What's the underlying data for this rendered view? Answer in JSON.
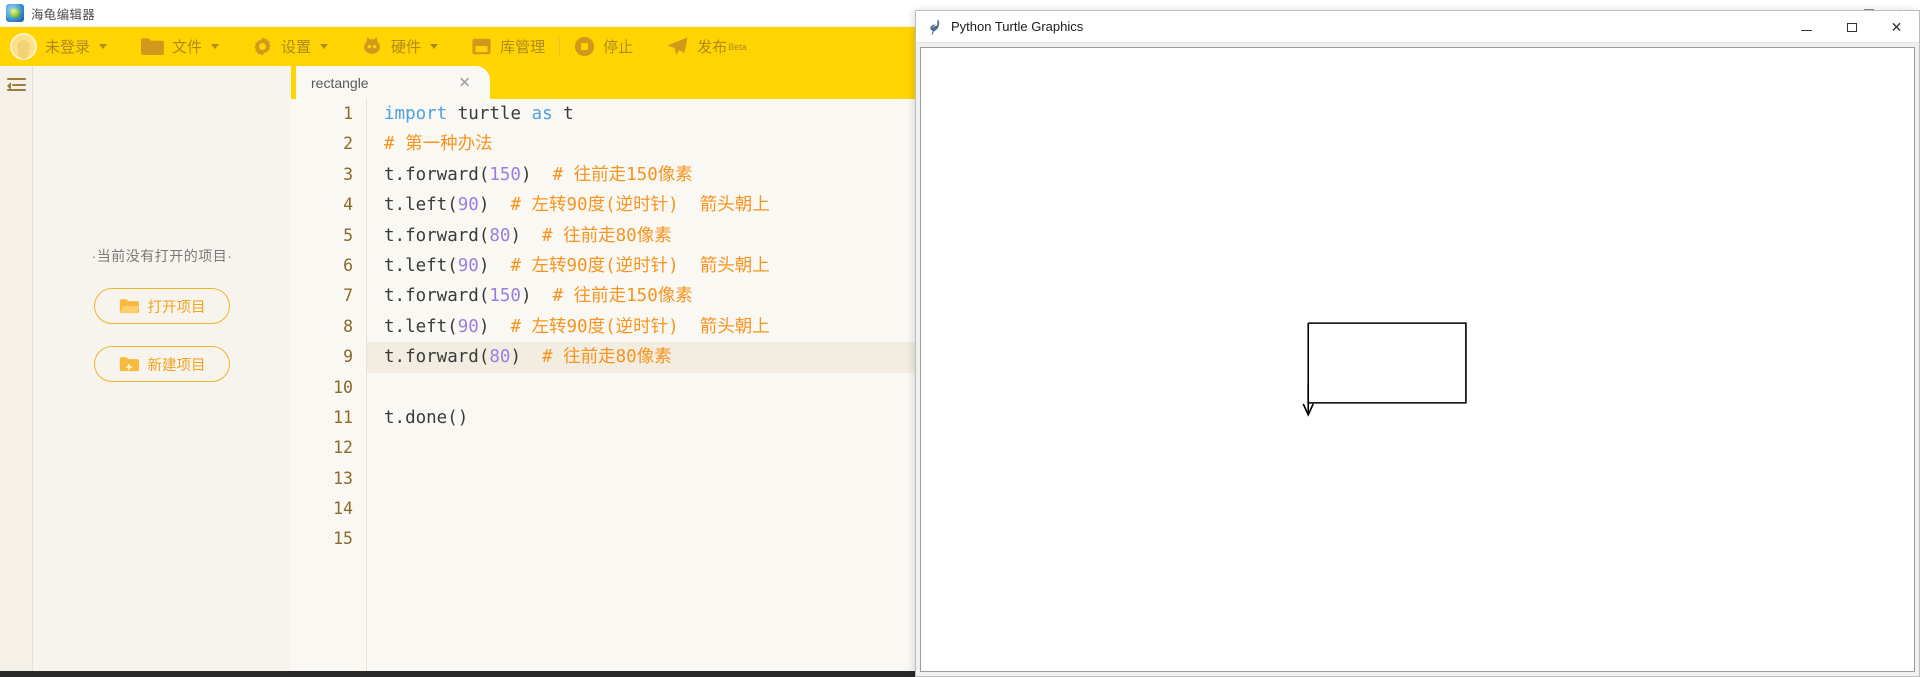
{
  "app": {
    "title": "海龟编辑器",
    "logo_icon": "turtle-logo-icon",
    "window_controls": {
      "minimize": "minimize-icon",
      "maximize": "maximize-icon",
      "close": "close-icon"
    }
  },
  "toolbar": {
    "account": {
      "label": "未登录",
      "icon": "avatar-icon",
      "caret": "chevron-down-icon"
    },
    "file": {
      "label": "文件",
      "icon": "folder-icon",
      "caret": "chevron-down-icon"
    },
    "settings": {
      "label": "设置",
      "icon": "gear-icon",
      "caret": "chevron-down-icon"
    },
    "hardware": {
      "label": "硬件",
      "icon": "chip-icon",
      "caret": "chevron-down-icon"
    },
    "library": {
      "label": "库管理",
      "icon": "inbox-icon"
    },
    "stop": {
      "label": "停止",
      "icon": "stop-circle-icon"
    },
    "publish": {
      "label": "发布",
      "badge": "Beta",
      "icon": "send-icon"
    }
  },
  "rail": {
    "toggle_icon": "collapse-sidebar-icon"
  },
  "project_panel": {
    "empty_text": "·当前没有打开的项目·",
    "open_button": {
      "label": "打开项目",
      "icon": "folder-open-icon"
    },
    "new_button": {
      "label": "新建项目",
      "icon": "folder-plus-icon"
    }
  },
  "editor": {
    "tab": {
      "label": "rectangle",
      "close_icon": "close-icon"
    },
    "active_line": 9,
    "line_numbers": [
      1,
      2,
      3,
      4,
      5,
      6,
      7,
      8,
      9,
      10,
      11,
      12,
      13,
      14,
      15
    ],
    "code": [
      {
        "n": 1,
        "tokens": [
          {
            "t": "import ",
            "c": "kw"
          },
          {
            "t": "turtle ",
            "c": "pl"
          },
          {
            "t": "as ",
            "c": "kw"
          },
          {
            "t": "t",
            "c": "pl"
          }
        ]
      },
      {
        "n": 2,
        "tokens": [
          {
            "t": "# 第一种办法",
            "c": "cm"
          }
        ]
      },
      {
        "n": 3,
        "tokens": [
          {
            "t": "t.forward(",
            "c": "pl"
          },
          {
            "t": "150",
            "c": "num"
          },
          {
            "t": ")  ",
            "c": "pl"
          },
          {
            "t": "# 往前走150像素",
            "c": "cm"
          }
        ]
      },
      {
        "n": 4,
        "tokens": [
          {
            "t": "t.left(",
            "c": "pl"
          },
          {
            "t": "90",
            "c": "num"
          },
          {
            "t": ")  ",
            "c": "pl"
          },
          {
            "t": "# 左转90度(逆时针)  箭头朝上",
            "c": "cm"
          }
        ]
      },
      {
        "n": 5,
        "tokens": [
          {
            "t": "t.forward(",
            "c": "pl"
          },
          {
            "t": "80",
            "c": "num"
          },
          {
            "t": ")  ",
            "c": "pl"
          },
          {
            "t": "# 往前走80像素",
            "c": "cm"
          }
        ]
      },
      {
        "n": 6,
        "tokens": [
          {
            "t": "t.left(",
            "c": "pl"
          },
          {
            "t": "90",
            "c": "num"
          },
          {
            "t": ")  ",
            "c": "pl"
          },
          {
            "t": "# 左转90度(逆时针)  箭头朝上",
            "c": "cm"
          }
        ]
      },
      {
        "n": 7,
        "tokens": [
          {
            "t": "t.forward(",
            "c": "pl"
          },
          {
            "t": "150",
            "c": "num"
          },
          {
            "t": ")  ",
            "c": "pl"
          },
          {
            "t": "# 往前走150像素",
            "c": "cm"
          }
        ]
      },
      {
        "n": 8,
        "tokens": [
          {
            "t": "t.left(",
            "c": "pl"
          },
          {
            "t": "90",
            "c": "num"
          },
          {
            "t": ")  ",
            "c": "pl"
          },
          {
            "t": "# 左转90度(逆时针)  箭头朝上",
            "c": "cm"
          }
        ]
      },
      {
        "n": 9,
        "tokens": [
          {
            "t": "t.forward(",
            "c": "pl"
          },
          {
            "t": "80",
            "c": "num"
          },
          {
            "t": ")  ",
            "c": "pl"
          },
          {
            "t": "# 往前走80像素",
            "c": "cm"
          }
        ]
      },
      {
        "n": 10,
        "tokens": []
      },
      {
        "n": 11,
        "tokens": [
          {
            "t": "t.done()",
            "c": "pl"
          }
        ]
      },
      {
        "n": 12,
        "tokens": []
      },
      {
        "n": 13,
        "tokens": []
      },
      {
        "n": 14,
        "tokens": []
      },
      {
        "n": 15,
        "tokens": []
      }
    ]
  },
  "turtle_window": {
    "title": "Python Turtle Graphics",
    "icon": "python-feather-icon",
    "window_controls": {
      "minimize": "minimize-icon",
      "maximize": "maximize-icon",
      "close": "close-icon"
    },
    "drawing": {
      "shape": "rectangle",
      "stroke_color": "#000000",
      "turtle_cursor": "arrow-down-icon"
    }
  },
  "colors": {
    "brand_yellow": "#ffd400",
    "panel_cream": "#f7f4ee",
    "editor_bg": "#faf8f2",
    "comment_orange": "#f79421",
    "keyword_blue": "#4ea0e8",
    "number_purple": "#9b7fe0",
    "accent_orange": "#f0a41c"
  }
}
